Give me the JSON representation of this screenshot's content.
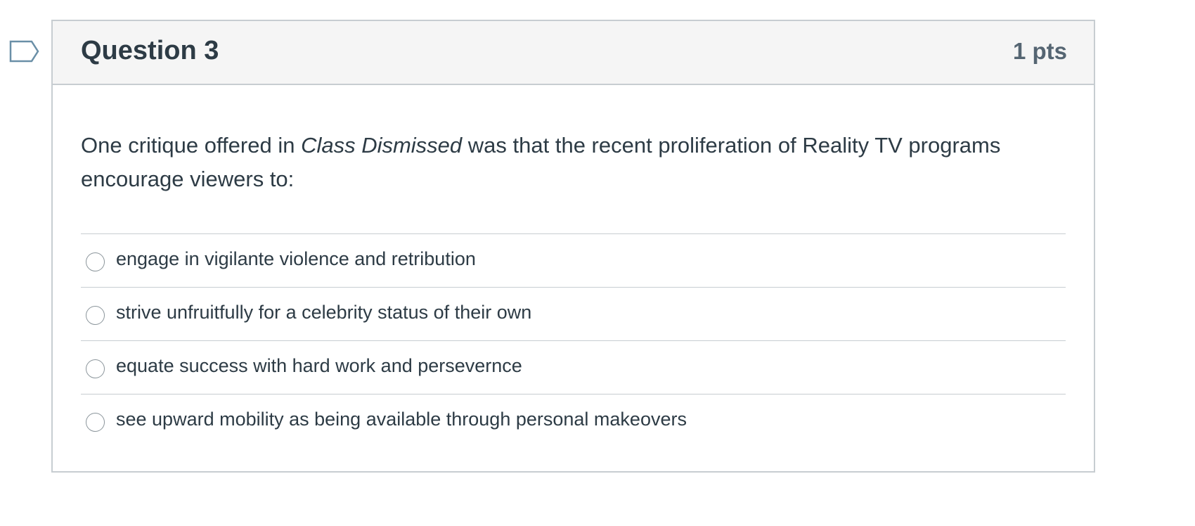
{
  "question": {
    "title": "Question 3",
    "points": "1 pts",
    "text_before": "One critique offered in ",
    "text_italic": "Class Dismissed",
    "text_after": " was that the recent proliferation of Reality TV programs encourage viewers to:",
    "answers": [
      {
        "label": "engage in vigilante violence and retribution",
        "selected": false
      },
      {
        "label": "strive unfruitfully for a celebrity status of their own",
        "selected": false
      },
      {
        "label": "equate success with hard work and persevernce",
        "selected": false
      },
      {
        "label": "see upward mobility as being available through personal makeovers",
        "selected": false
      }
    ]
  },
  "flag": {
    "icon": "flag-question-icon",
    "color": "#6a8fa7"
  },
  "colors": {
    "text": "#2d3b45",
    "points": "#556572",
    "border": "#c7cdd1",
    "header_bg": "#f5f5f5"
  }
}
